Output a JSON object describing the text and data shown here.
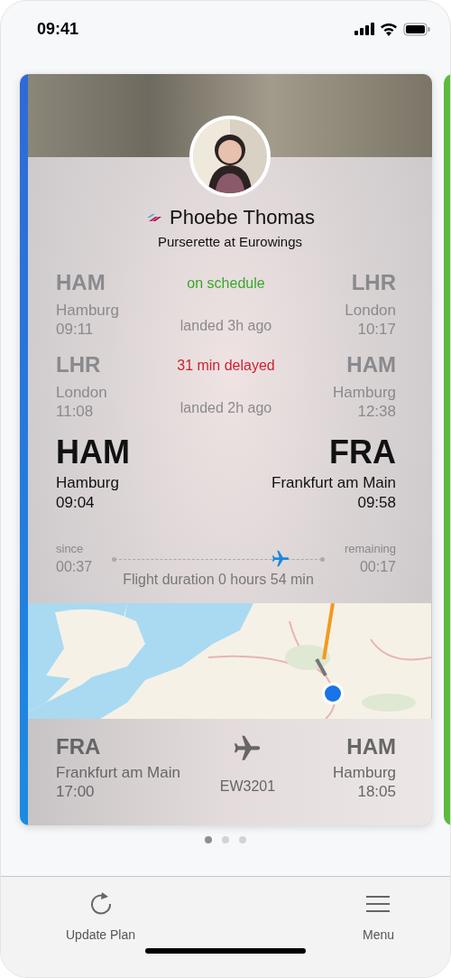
{
  "status_bar": {
    "time": "09:41"
  },
  "crew": {
    "name": "Phoebe Thomas",
    "role": "Purserette at Eurowings"
  },
  "flights": [
    {
      "kind": "past",
      "from": {
        "code": "HAM",
        "city": "Hamburg",
        "time": "09:11"
      },
      "to": {
        "code": "LHR",
        "city": "London",
        "time": "10:17"
      },
      "status": "on schedule",
      "color": "#3aa629",
      "note": "landed 3h ago"
    },
    {
      "kind": "past",
      "from": {
        "code": "LHR",
        "city": "London",
        "time": "11:08"
      },
      "to": {
        "code": "HAM",
        "city": "Hamburg",
        "time": "12:38"
      },
      "status": "31 min delayed",
      "color": "#d0202f",
      "note": "landed 2h ago"
    },
    {
      "kind": "current",
      "from": {
        "code": "HAM",
        "city": "Hamburg",
        "time": "09:04"
      },
      "to": {
        "code": "FRA",
        "city": "Frankfurt am Main",
        "time": "09:58"
      }
    }
  ],
  "progress": {
    "since_label": "since",
    "since": "00:37",
    "remaining_label": "remaining",
    "remaining": "00:17",
    "level": 0.8,
    "duration": "Flight duration 0 hours 54 min"
  },
  "next_flight": {
    "from": {
      "code": "FRA",
      "city": "Frankfurt am Main",
      "time": "17:00"
    },
    "to": {
      "code": "HAM",
      "city": "Hamburg",
      "time": "18:05"
    },
    "number": "EW3201"
  },
  "pages": [
    {
      "selected": true
    },
    {
      "selected": false
    },
    {
      "selected": false
    }
  ],
  "tab_bar": [
    {
      "kind": "refresh",
      "label": "Update Plan"
    },
    {
      "kind": "menu",
      "label": "Menu"
    }
  ]
}
